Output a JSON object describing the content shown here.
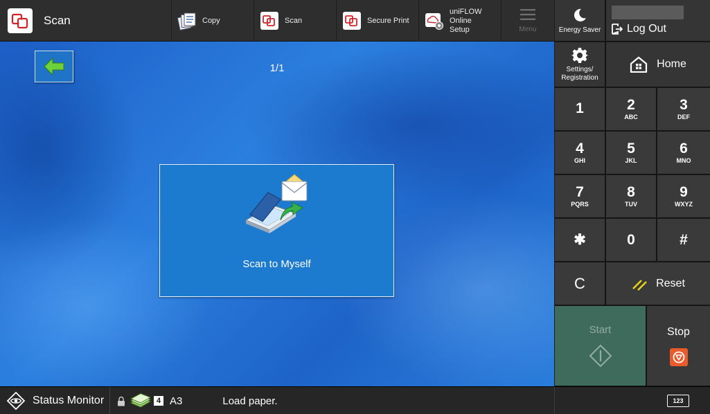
{
  "header": {
    "app_title": "Scan",
    "shortcuts": [
      {
        "label": "Copy",
        "icon": "copy-icon"
      },
      {
        "label": "Scan",
        "icon": "scan-app-icon"
      },
      {
        "label": "Secure Print",
        "icon": "secure-print-icon"
      },
      {
        "label_line1": "uniFLOW Online",
        "label_line2": "Setup",
        "icon": "uniflow-setup-icon"
      }
    ],
    "menu_label": "Menu"
  },
  "main": {
    "page_indicator": "1/1",
    "tiles": [
      {
        "label": "Scan to Myself",
        "icon": "scan-to-myself-icon"
      }
    ]
  },
  "right_panel": {
    "energy_saver_label": "Energy Saver",
    "logout_label": "Log Out",
    "settings_label_line1": "Settings/",
    "settings_label_line2": "Registration",
    "home_label": "Home",
    "keypad": [
      {
        "digit": "1",
        "letters": ""
      },
      {
        "digit": "2",
        "letters": "ABC"
      },
      {
        "digit": "3",
        "letters": "DEF"
      },
      {
        "digit": "4",
        "letters": "GHI"
      },
      {
        "digit": "5",
        "letters": "JKL"
      },
      {
        "digit": "6",
        "letters": "MNO"
      },
      {
        "digit": "7",
        "letters": "PQRS"
      },
      {
        "digit": "8",
        "letters": "TUV"
      },
      {
        "digit": "9",
        "letters": "WXYZ"
      },
      {
        "digit": "✱",
        "letters": ""
      },
      {
        "digit": "0",
        "letters": ""
      },
      {
        "digit": "#",
        "letters": ""
      }
    ],
    "clear_label": "C",
    "reset_label": "Reset",
    "start_label": "Start",
    "stop_label": "Stop"
  },
  "status_bar": {
    "status_monitor_label": "Status Monitor",
    "paper_count": "4",
    "paper_size": "A3",
    "message": "Load paper.",
    "keypad_toggle_label": "123"
  },
  "colors": {
    "start_disabled": "#3f6b5d",
    "stop_icon": "#ea5b2a",
    "reset_icon": "#e8d21c",
    "tile_bg": "#1d7bcf"
  }
}
